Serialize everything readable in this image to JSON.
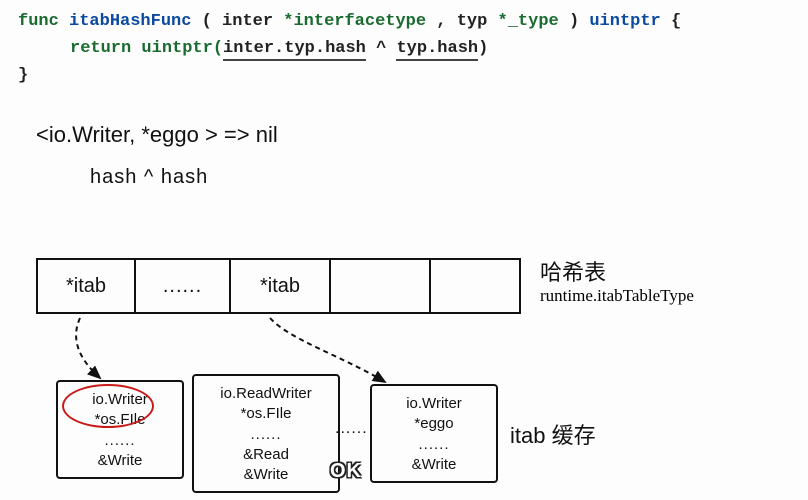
{
  "code": {
    "keyword_func": "func",
    "func_name": "itabHashFunc",
    "param_open": "(",
    "param1_name": "inter",
    "param1_type": "*interfacetype",
    "comma": ",",
    "param2_name": "typ",
    "param2_type": "*_type",
    "param_close": ")",
    "ret_type": "uintptr",
    "brace_open": "{",
    "keyword_return": "return",
    "call_open": "uintptr(",
    "expr_left": "inter.typ.hash",
    "op": "^",
    "expr_right": "typ.hash",
    "call_close": ")",
    "brace_close": "}"
  },
  "expression": {
    "line1": "<io.Writer, *eggo >   => nil",
    "line2": "hash  ^   hash"
  },
  "hashtable": {
    "cells": [
      "*itab",
      "......",
      "*itab",
      "",
      ""
    ],
    "label": "哈希表",
    "subtype": "runtime.itabTableType"
  },
  "itabs": {
    "box1": {
      "l1": "io.Writer",
      "l2": "*os.FIle",
      "dots": "......",
      "l3": "&Write"
    },
    "box2": {
      "l1": "io.ReadWriter",
      "l2": "*os.FIle",
      "dots": "......",
      "l3a": "&Read",
      "l3b": "&Write"
    },
    "box3": {
      "l1": "io.Writer",
      "l2": "*eggo",
      "dots": "......",
      "l3": "&Write"
    },
    "gap_dots": "......",
    "cache_label": "itab 缓存"
  },
  "badge": {
    "ok": "OK"
  }
}
